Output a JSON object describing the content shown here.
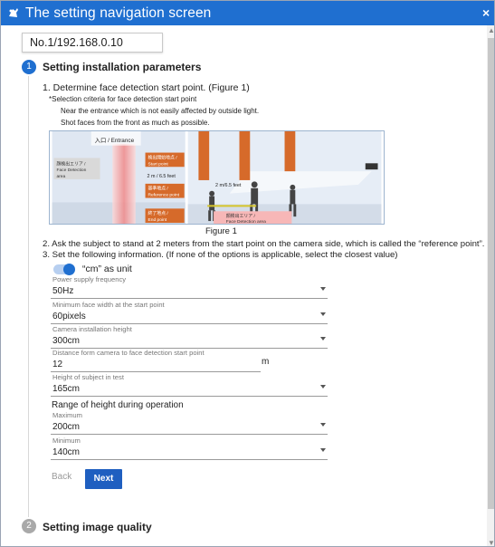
{
  "window": {
    "title": "The setting navigation screen",
    "close_glyph": "×"
  },
  "address": "No.1/192.168.0.10",
  "step1": {
    "number": "1",
    "title": "Setting installation parameters",
    "instruction1": "1. Determine face detection start point. (Figure 1)",
    "selection_title": "*Selection criteria for face detection start point",
    "criteria": [
      "Near the entrance which is not easily affected by outside light.",
      "Shot faces from the front as much as possible."
    ],
    "figure": {
      "caption": "Figure 1",
      "labels": {
        "entrance": "入口 / Entrance",
        "face_area_left": "顔検出エリア /\nFace Detection\narea",
        "start_point": "検出開始地点 /\nStart point",
        "distance_left": "2 m / 6.5 feet",
        "reference_point": "基準地点 /\nReference point",
        "end_point": "終了地点 /\nEnd point",
        "start_vertical": "検出開始地点 / Start point",
        "reference_vertical": "基準地点 / Reference point",
        "end_vertical": "終了地点 / End point",
        "distance_right": "2 m/6.5 feet",
        "face_area_right": "顔検出エリア /\nFace Detection area"
      }
    },
    "instruction2": "2. Ask the subject to stand at 2 meters from the start point on the camera side, which is called the “reference point”.",
    "instruction3": "3. Set the following information. (If none of the options is applicable, select the closest value)",
    "unit_toggle": {
      "label": "“cm” as unit",
      "on": true
    },
    "fields": {
      "power": {
        "label": "Power supply frequency",
        "value": "50Hz"
      },
      "face_width": {
        "label": "Minimum face width at the start point",
        "value": "60pixels"
      },
      "camera_height": {
        "label": "Camera installation height",
        "value": "300cm"
      },
      "distance": {
        "label": "Distance form camera to face detection start point",
        "value": "12",
        "unit": "m"
      },
      "subject_height": {
        "label": "Height of subject in test",
        "value": "165cm"
      }
    },
    "range": {
      "title": "Range of height during operation",
      "maximum": {
        "label": "Maximum",
        "value": "200cm"
      },
      "minimum": {
        "label": "Minimum",
        "value": "140cm"
      }
    },
    "buttons": {
      "back": "Back",
      "next": "Next"
    }
  },
  "step2": {
    "number": "2",
    "title": "Setting image quality"
  },
  "colors": {
    "accent": "#1f6fd0",
    "next_button": "#1f5fc0",
    "marker_orange": "#d66a2a",
    "area_pink": "#f7b7b7"
  }
}
